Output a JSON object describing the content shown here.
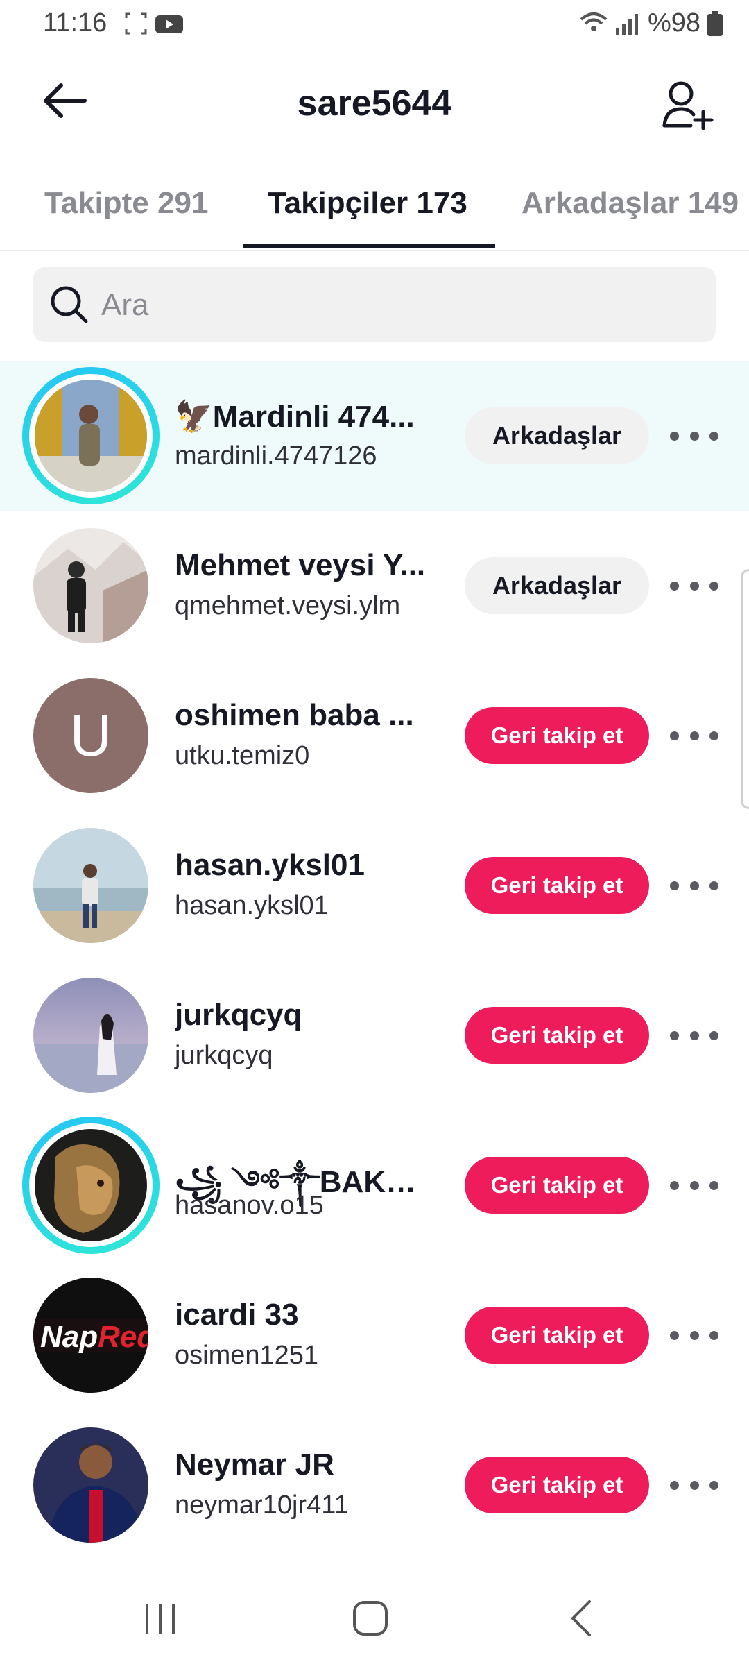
{
  "status_bar": {
    "time": "11:16",
    "battery": "%98"
  },
  "header": {
    "title": "sare5644"
  },
  "tabs": [
    {
      "label": "Takipte 291"
    },
    {
      "label": "Takipçiler 173"
    },
    {
      "label": "Arkadaşlar 149"
    }
  ],
  "search": {
    "placeholder": "Ara"
  },
  "users": [
    {
      "name": "🦅Mardinli 474...",
      "handle": "mardinli.4747126",
      "button": "Arkadaşlar"
    },
    {
      "name": "Mehmet veysi Y...",
      "handle": "qmehmet.veysi.ylm",
      "button": "Arkadaşlar"
    },
    {
      "name": "oshimen baba ...",
      "handle": "utku.temiz0",
      "button": "Geri takip et",
      "initial": "U"
    },
    {
      "name": "hasan.yksl01",
      "handle": "hasan.yksl01",
      "button": "Geri takip et"
    },
    {
      "name": "jurkqcyq",
      "handle": "jurkqcyq",
      "button": "Geri takip et"
    },
    {
      "name": "꧁ ༺༒BAKu*/*...",
      "handle": "hasanov.o15",
      "button": "Geri takip et"
    },
    {
      "name": "icardi 33",
      "handle": "osimen1251",
      "button": "Geri takip et",
      "avatar_text": "NapRed"
    },
    {
      "name": "Neymar JR",
      "handle": "neymar10jr411",
      "button": "Geri takip et"
    }
  ],
  "colors": {
    "follow_back": "#ef1c5c",
    "friends": "#f1f1f2",
    "highlight_row": "#effafb",
    "story_ring": "#25c6f4"
  }
}
